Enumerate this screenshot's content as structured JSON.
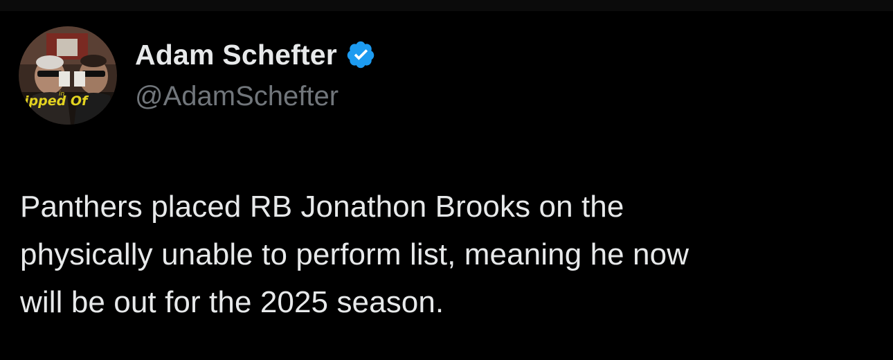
{
  "author": {
    "display_name": "Adam Schefter",
    "handle": "@AdamSchefter",
    "verified": true,
    "verified_color": "#1d9bf0",
    "avatar_text": "Tipped Off",
    "avatar_icon": "profile-photo-two-men-sunglasses"
  },
  "tweet": {
    "lines": [
      "Panthers placed RB Jonathon Brooks on the",
      "physically unable to perform list, meaning he now",
      "will be out for the 2025 season."
    ]
  },
  "colors": {
    "background": "#000000",
    "primary_text": "#e7e9ea",
    "secondary_text": "#71767b",
    "accent": "#1d9bf0"
  }
}
